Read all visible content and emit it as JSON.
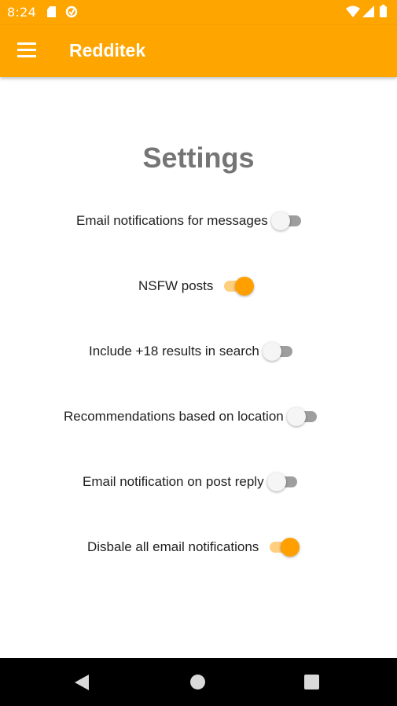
{
  "status_bar": {
    "time": "8:24",
    "icons": [
      "sd-card-icon",
      "sync-icon",
      "wifi-icon",
      "signal-icon",
      "battery-icon"
    ]
  },
  "app_bar": {
    "title": "Redditek",
    "menu_icon": "menu-icon"
  },
  "page": {
    "title": "Settings"
  },
  "settings": [
    {
      "label": "Email notifications for messages",
      "enabled": false
    },
    {
      "label": "NSFW posts",
      "enabled": true
    },
    {
      "label": "Include +18 results in search",
      "enabled": false
    },
    {
      "label": "Recommendations based on location",
      "enabled": false
    },
    {
      "label": "Email notification on post reply",
      "enabled": false
    },
    {
      "label": "Disbale all email notifications",
      "enabled": true
    }
  ],
  "nav_bar": {
    "icons": [
      "back-icon",
      "home-icon",
      "recents-icon"
    ]
  },
  "colors": {
    "accent": "#ffa500",
    "switch_on_thumb": "#ffa000",
    "switch_on_track": "#ffcf80",
    "switch_off_track": "#9e9e9e",
    "title_text": "#757575"
  }
}
